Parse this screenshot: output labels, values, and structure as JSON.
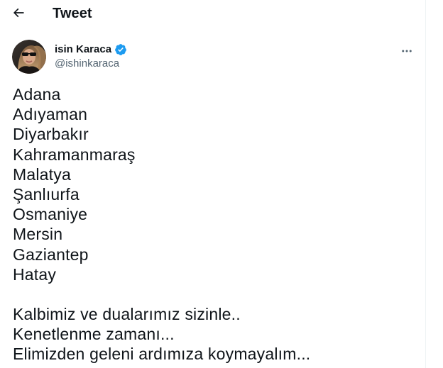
{
  "header": {
    "back_icon": "arrow-left-icon",
    "title": "Tweet"
  },
  "author": {
    "avatar": "profile-photo",
    "display_name": "isin Karaca",
    "verified_icon": "verified-badge-icon",
    "verified_color": "#1d9bf0",
    "handle": "@ishinkaraca",
    "more_icon": "more-horizontal-icon"
  },
  "tweet": {
    "cities": [
      "Adana",
      "Adıyaman",
      "Diyarbakır",
      "Kahramanmaraş",
      "Malatya",
      "Şanlıurfa",
      "Osmaniye",
      "Mersin",
      "Gaziantep",
      "Hatay"
    ],
    "closing_lines": [
      "Kalbimiz ve dualarımız sizinle..",
      "Kenetlenme zamanı...",
      "Elimizden geleni ardımıza koymayalım..."
    ]
  }
}
